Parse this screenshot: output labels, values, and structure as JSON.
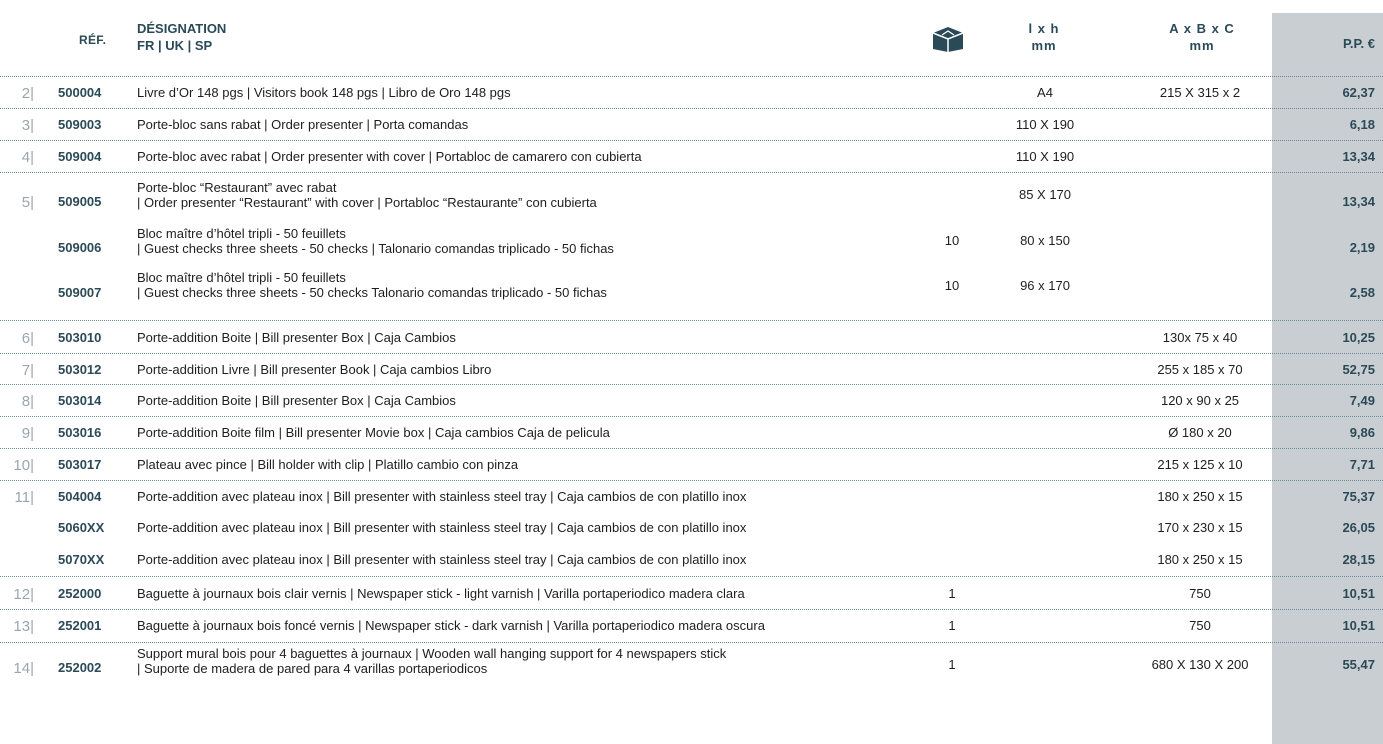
{
  "header": {
    "ref": "RÉF.",
    "designation_line1": "DÉSIGNATION",
    "designation_line2": "FR | UK | SP",
    "box_icon": "box-open-icon",
    "lh_line1": "l x h",
    "lh_line2": "mm",
    "abc_line1": "A x B x C",
    "abc_line2": "mm",
    "price": "P.P. €"
  },
  "colors": {
    "accent": "#2b4a57",
    "price_column": "#c9ced2",
    "separator": "#6b8896"
  },
  "rows": [
    {
      "num": "2|",
      "ref": "500004",
      "des": "Livre d’Or 148 pgs | Visitors book 148 pgs | Libro de Oro 148 pgs",
      "qty": "",
      "lh": "A4",
      "abc": "215 X 315 x 2",
      "price": "62,37"
    },
    {
      "num": "3|",
      "ref": "509003",
      "des": "Porte-bloc sans rabat | Order presenter | Porta comandas",
      "qty": "",
      "lh": "110 X 190",
      "abc": "",
      "price": "6,18"
    },
    {
      "num": "4|",
      "ref": "509004",
      "des": "Porte-bloc avec rabat | Order presenter with cover | Portabloc de camarero con cubierta",
      "qty": "",
      "lh": "110 X 190",
      "abc": "",
      "price": "13,34"
    },
    {
      "num": "5|",
      "ref": "509005",
      "des": "Porte-bloc “Restaurant” avec rabat\n| Order presenter “Restaurant” with cover | Portabloc “Restaurante” con cubierta",
      "qty": "",
      "lh": "85 X 170",
      "abc": "",
      "price": "13,34"
    },
    {
      "num": "",
      "ref": "509006",
      "des": "Bloc maître d’hôtel tripli - 50 feuillets\n| Guest checks three sheets - 50 checks | Talonario comandas triplicado - 50 fichas",
      "qty": "10",
      "lh": "80 x 150",
      "abc": "",
      "price": "2,19"
    },
    {
      "num": "",
      "ref": "509007",
      "des": "Bloc maître d’hôtel tripli - 50 feuillets\n| Guest checks three sheets - 50 checks Talonario comandas triplicado - 50 fichas",
      "qty": "10",
      "lh": "96 x 170",
      "abc": "",
      "price": "2,58"
    },
    {
      "num": "6|",
      "ref": "503010",
      "des": "Porte-addition Boite | Bill presenter Box | Caja Cambios",
      "qty": "",
      "lh": "",
      "abc": "130x 75 x 40",
      "price": "10,25"
    },
    {
      "num": "7|",
      "ref": "503012",
      "des": "Porte-addition Livre | Bill presenter Book | Caja cambios Libro",
      "qty": "",
      "lh": "",
      "abc": "255 x 185 x 70",
      "price": "52,75"
    },
    {
      "num": "8|",
      "ref": "503014",
      "des": "Porte-addition Boite | Bill presenter Box | Caja Cambios",
      "qty": "",
      "lh": "",
      "abc": "120 x 90 x 25",
      "price": "7,49"
    },
    {
      "num": "9|",
      "ref": "503016",
      "des": "Porte-addition Boite film | Bill presenter Movie box | Caja cambios Caja de pelicula",
      "qty": "",
      "lh": "",
      "abc": "Ø 180 x 20",
      "price": "9,86"
    },
    {
      "num": "10|",
      "ref": "503017",
      "des": "Plateau avec pince | Bill holder with clip | Platillo cambio con pinza",
      "qty": "",
      "lh": "",
      "abc": "215 x 125 x 10",
      "price": "7,71"
    },
    {
      "num": "11|",
      "ref": "504004",
      "des": "Porte-addition avec plateau inox | Bill presenter with stainless steel tray | Caja cambios de con platillo inox",
      "qty": "",
      "lh": "",
      "abc": "180 x 250 x 15",
      "price": "75,37"
    },
    {
      "num": "",
      "ref": "5060XX",
      "des": "Porte-addition avec plateau inox | Bill presenter with stainless steel tray | Caja cambios de con platillo inox",
      "qty": "",
      "lh": "",
      "abc": "170 x 230 x 15",
      "price": "26,05"
    },
    {
      "num": "",
      "ref": "5070XX",
      "des": "Porte-addition avec plateau inox | Bill presenter with stainless steel tray | Caja cambios de con platillo inox",
      "qty": "",
      "lh": "",
      "abc": "180 x 250 x 15",
      "price": "28,15"
    },
    {
      "num": "12|",
      "ref": "252000",
      "des": "Baguette à journaux bois clair vernis | Newspaper stick - light varnish | Varilla portaperiodico madera clara",
      "qty": "1",
      "lh": "",
      "abc": "750",
      "price": "10,51"
    },
    {
      "num": "13|",
      "ref": "252001",
      "des": "Baguette à journaux bois foncé vernis | Newspaper stick - dark varnish | Varilla portaperiodico madera oscura",
      "qty": "1",
      "lh": "",
      "abc": "750",
      "price": "10,51"
    },
    {
      "num": "14|",
      "ref": "252002",
      "des": "Support mural bois pour 4 baguettes à journaux | Wooden wall hanging support  for 4 newspapers stick\n| Suporte de madera de pared para 4 varillas portaperiodicos",
      "qty": "1",
      "lh": "",
      "abc": "680 X 130 X 200",
      "price": "55,47"
    }
  ]
}
